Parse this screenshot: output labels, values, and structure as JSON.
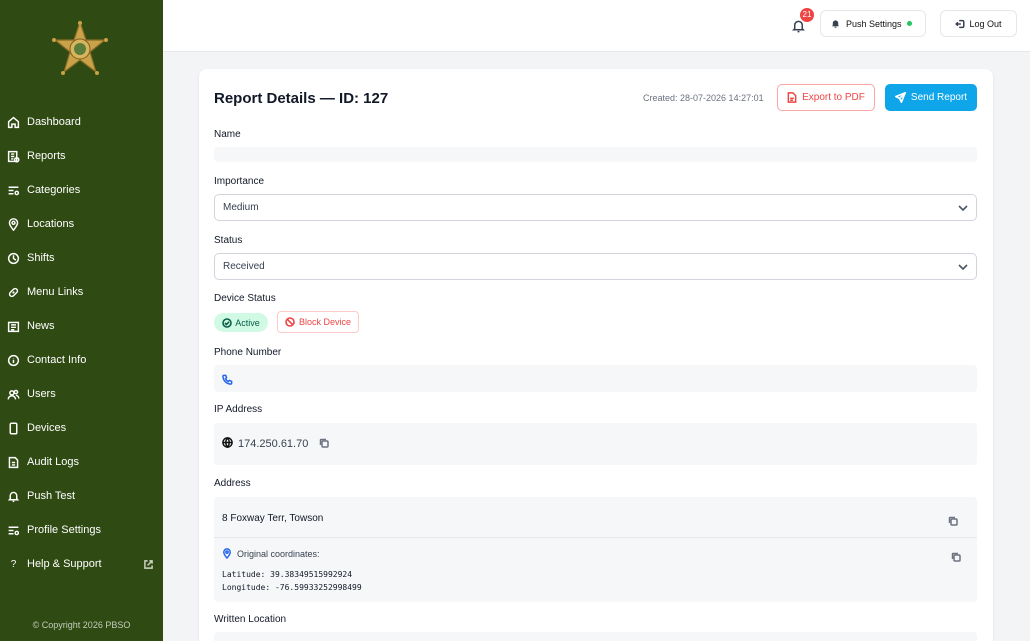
{
  "sidebar": {
    "items": [
      {
        "label": "Dashboard",
        "icon": "home-icon"
      },
      {
        "label": "Reports",
        "icon": "reports-icon"
      },
      {
        "label": "Categories",
        "icon": "categories-icon"
      },
      {
        "label": "Locations",
        "icon": "location-pin-icon"
      },
      {
        "label": "Shifts",
        "icon": "clock-icon"
      },
      {
        "label": "Menu Links",
        "icon": "link-icon"
      },
      {
        "label": "News",
        "icon": "news-icon"
      },
      {
        "label": "Contact Info",
        "icon": "info-icon"
      },
      {
        "label": "Users",
        "icon": "users-icon"
      },
      {
        "label": "Devices",
        "icon": "device-icon"
      },
      {
        "label": "Audit Logs",
        "icon": "file-icon"
      },
      {
        "label": "Push Test",
        "icon": "bell-icon"
      },
      {
        "label": "Profile Settings",
        "icon": "sliders-icon"
      },
      {
        "label": "Help & Support",
        "icon": "question-icon"
      }
    ],
    "copyright": "© Copyright 2026 PBSO"
  },
  "topbar": {
    "notification_count": "21",
    "push_settings_label": "Push Settings",
    "logout_label": "Log Out"
  },
  "report": {
    "title": "Report Details — ID: 127",
    "created": "Created: 28-07-2026 14:27:01",
    "export_label": "Export to PDF",
    "send_label": "Send Report",
    "labels": {
      "name": "Name",
      "importance": "Importance",
      "status": "Status",
      "device_status": "Device Status",
      "phone": "Phone Number",
      "ip": "IP Address",
      "address": "Address",
      "written_location": "Written Location"
    },
    "name_value": "",
    "importance_value": "Medium",
    "status_value": "Received",
    "device_active_label": "Active",
    "block_device_label": "Block Device",
    "phone_value": "",
    "ip_value": "174.250.61.70",
    "address_value": "8 Foxway Terr, Towson",
    "coords_label": "Original coordinates:",
    "latitude": "Latitude: 39.38349515992924",
    "longitude": "Longitude: -76.59933252998499"
  },
  "colors": {
    "sidebar_bg": "#2f4a13",
    "accent_blue": "#0ea5e9",
    "danger": "#ef4444",
    "active_green": "#d1fae5"
  }
}
